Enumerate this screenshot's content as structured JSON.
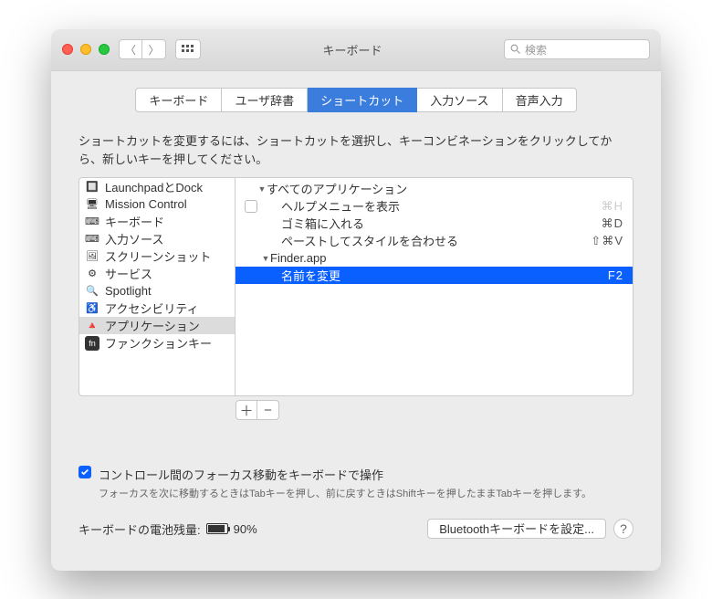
{
  "window": {
    "title": "キーボード",
    "search_placeholder": "検索"
  },
  "tabs": [
    "キーボード",
    "ユーザ辞書",
    "ショートカット",
    "入力ソース",
    "音声入力"
  ],
  "active_tab": 2,
  "instruction": "ショートカットを変更するには、ショートカットを選択し、キーコンビネーションをクリックしてから、新しいキーを押してください。",
  "sidebar": {
    "items": [
      {
        "label": "LaunchpadとDock",
        "icon": "🚀"
      },
      {
        "label": "Mission Control",
        "icon": "🖥"
      },
      {
        "label": "キーボード",
        "icon": "⌨"
      },
      {
        "label": "入力ソース",
        "icon": "🌐"
      },
      {
        "label": "スクリーンショット",
        "icon": "🖼"
      },
      {
        "label": "サービス",
        "icon": "⚙"
      },
      {
        "label": "Spotlight",
        "icon": "🔍"
      },
      {
        "label": "アクセシビリティ",
        "icon": "♿"
      },
      {
        "label": "アプリケーション",
        "icon": "📐"
      },
      {
        "label": "ファンクションキー",
        "icon": "fn"
      }
    ],
    "selected": 8
  },
  "shortcuts": {
    "groups": [
      {
        "name": "すべてのアプリケーション",
        "rows": [
          {
            "label": "ヘルプメニューを表示",
            "key": "⌘H",
            "checked": false,
            "dim": true
          },
          {
            "label": "ゴミ箱に入れる",
            "key": "⌘D"
          },
          {
            "label": "ペーストしてスタイルを合わせる",
            "key": "⇧⌘V"
          }
        ]
      },
      {
        "name": "Finder.app",
        "rows": [
          {
            "label": "名前を変更",
            "key": "F2",
            "selected": true
          }
        ]
      }
    ]
  },
  "focus_checkbox": {
    "label": "コントロール間のフォーカス移動をキーボードで操作",
    "hint": "フォーカスを次に移動するときはTabキーを押し、前に戻すときはShiftキーを押したままTabキーを押します。"
  },
  "battery": {
    "label": "キーボードの電池残量:",
    "value": "90%"
  },
  "bluetooth_btn": "Bluetoothキーボードを設定..."
}
